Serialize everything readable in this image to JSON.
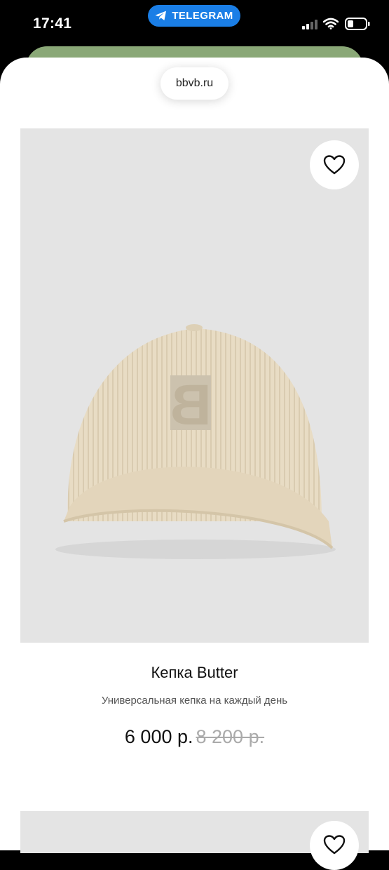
{
  "status_bar": {
    "time": "17:41",
    "app_pill": "TELEGRAM",
    "app_pill_color": "#1a7ee6",
    "icons": [
      "telegram-icon",
      "signal-icon",
      "wifi-icon",
      "battery-icon"
    ]
  },
  "browser": {
    "url": "bbvb.ru"
  },
  "product": {
    "title": "Кепка Butter",
    "description": "Универсальная кепка на каждый день",
    "price": "6 000 р.",
    "old_price": "8 200 р.",
    "image_alt_icon": "cap-product-image",
    "favorite_icon": "heart-icon"
  },
  "colors": {
    "image_background": "#e4e4e4",
    "cap": "#e8dcc4",
    "old_price": "#aaaaaa"
  }
}
